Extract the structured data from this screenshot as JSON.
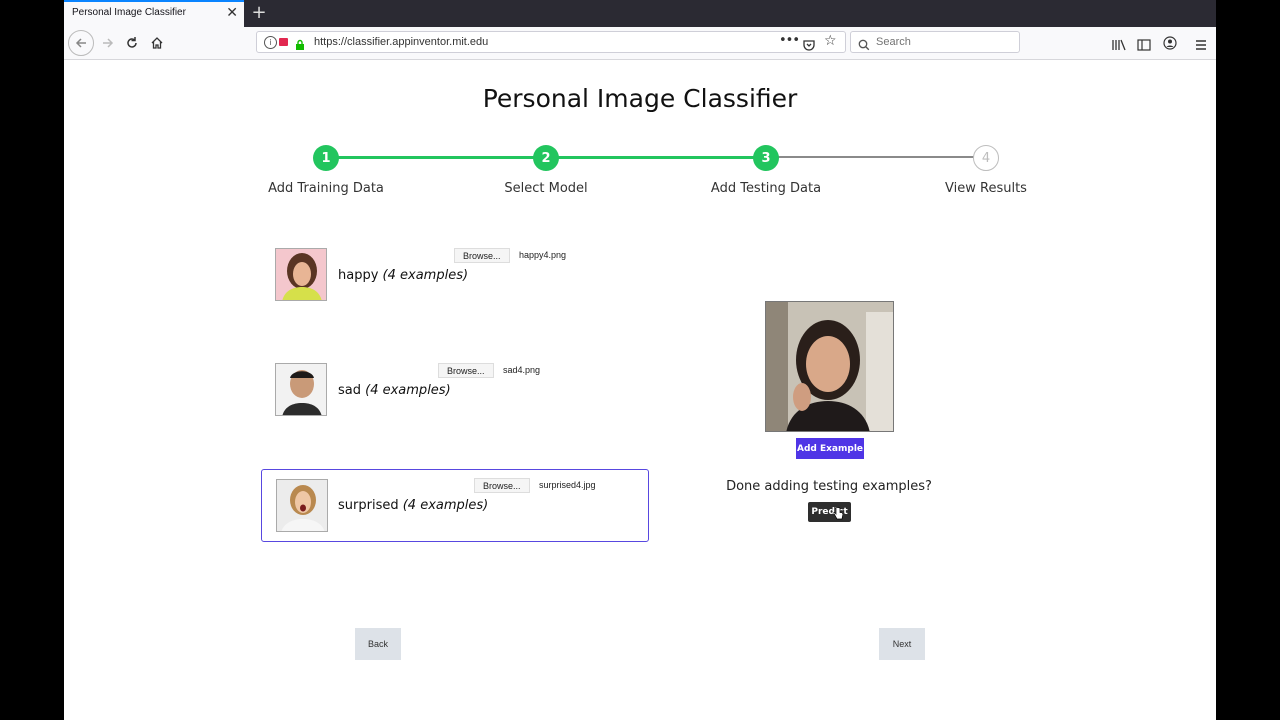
{
  "browser": {
    "tab_title": "Personal Image Classifier",
    "url": "https://classifier.appinventor.mit.edu",
    "search_placeholder": "Search"
  },
  "page": {
    "title": "Personal Image Classifier",
    "steps": [
      {
        "number": "1",
        "label": "Add Training Data",
        "state": "complete"
      },
      {
        "number": "2",
        "label": "Select Model",
        "state": "complete"
      },
      {
        "number": "3",
        "label": "Add Testing Data",
        "state": "current"
      },
      {
        "number": "4",
        "label": "View Results",
        "state": "upcoming"
      }
    ],
    "classes": [
      {
        "name": "happy",
        "examples": "(4 examples)",
        "browse_label": "Browse...",
        "file": "happy4.png",
        "selected": false
      },
      {
        "name": "sad",
        "examples": "(4 examples)",
        "browse_label": "Browse...",
        "file": "sad4.png",
        "selected": false
      },
      {
        "name": "surprised",
        "examples": "(4 examples)",
        "browse_label": "Browse...",
        "file": "surprised4.jpg",
        "selected": true
      }
    ],
    "add_example_label": "Add Example",
    "done_prompt": "Done adding testing examples?",
    "predict_label": "Predict",
    "back_label": "Back",
    "next_label": "Next"
  },
  "colors": {
    "step_complete": "#22c55e",
    "step_upcoming": "#bdbdbd",
    "accent": "#4f35e6",
    "selected_border": "#5848e0"
  }
}
